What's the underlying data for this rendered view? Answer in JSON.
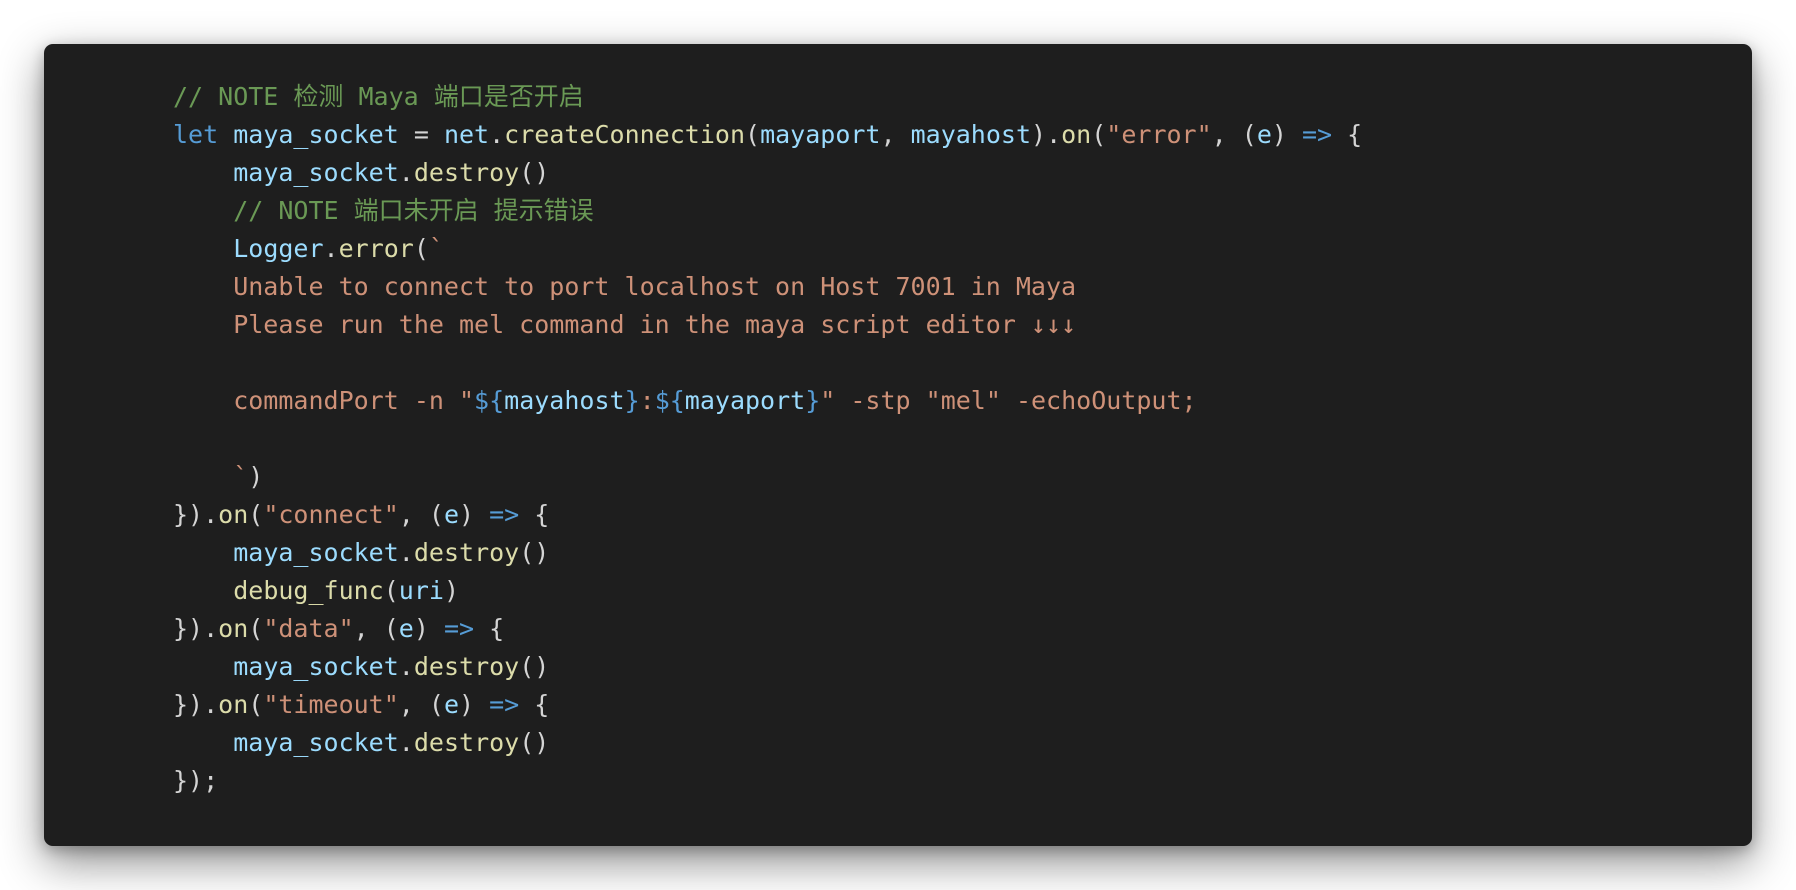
{
  "editor": {
    "background": "#1e1e1e",
    "font_size_hint": "monospace code snippet",
    "colors": {
      "default": "#d4d4d4",
      "comment": "#6a9955",
      "keyword": "#569cd6",
      "variable": "#9cdcfe",
      "function": "#dcdcaa",
      "string": "#ce9178"
    },
    "lines": [
      [
        {
          "t": "// NOTE 检测 Maya 端口是否开启",
          "c": "comment"
        }
      ],
      [
        {
          "t": "let",
          "c": "keyword"
        },
        {
          "t": " ",
          "c": "default"
        },
        {
          "t": "maya_socket",
          "c": "variable"
        },
        {
          "t": " = ",
          "c": "default"
        },
        {
          "t": "net",
          "c": "variable"
        },
        {
          "t": ".",
          "c": "default"
        },
        {
          "t": "createConnection",
          "c": "function"
        },
        {
          "t": "(",
          "c": "default"
        },
        {
          "t": "mayaport",
          "c": "variable"
        },
        {
          "t": ", ",
          "c": "default"
        },
        {
          "t": "mayahost",
          "c": "variable"
        },
        {
          "t": ").",
          "c": "default"
        },
        {
          "t": "on",
          "c": "function"
        },
        {
          "t": "(",
          "c": "default"
        },
        {
          "t": "\"error\"",
          "c": "string"
        },
        {
          "t": ", (",
          "c": "default"
        },
        {
          "t": "e",
          "c": "variable"
        },
        {
          "t": ") ",
          "c": "default"
        },
        {
          "t": "=>",
          "c": "keyword"
        },
        {
          "t": " {",
          "c": "default"
        }
      ],
      [
        {
          "t": "    ",
          "c": "default"
        },
        {
          "t": "maya_socket",
          "c": "variable"
        },
        {
          "t": ".",
          "c": "default"
        },
        {
          "t": "destroy",
          "c": "function"
        },
        {
          "t": "()",
          "c": "default"
        }
      ],
      [
        {
          "t": "    ",
          "c": "default"
        },
        {
          "t": "// NOTE 端口未开启 提示错误",
          "c": "comment"
        }
      ],
      [
        {
          "t": "    ",
          "c": "default"
        },
        {
          "t": "Logger",
          "c": "variable"
        },
        {
          "t": ".",
          "c": "default"
        },
        {
          "t": "error",
          "c": "function"
        },
        {
          "t": "(",
          "c": "default"
        },
        {
          "t": "`",
          "c": "string"
        }
      ],
      [
        {
          "t": "    Unable to connect to port localhost on Host 7001 in Maya",
          "c": "string"
        }
      ],
      [
        {
          "t": "    Please run the mel command in the maya script editor ↓↓↓",
          "c": "string"
        }
      ],
      [
        {
          "t": "",
          "c": "default"
        }
      ],
      [
        {
          "t": "    commandPort -n \"",
          "c": "string"
        },
        {
          "t": "${",
          "c": "keyword"
        },
        {
          "t": "mayahost",
          "c": "variable"
        },
        {
          "t": "}",
          "c": "keyword"
        },
        {
          "t": ":",
          "c": "string"
        },
        {
          "t": "${",
          "c": "keyword"
        },
        {
          "t": "mayaport",
          "c": "variable"
        },
        {
          "t": "}",
          "c": "keyword"
        },
        {
          "t": "\" -stp \"mel\" -echoOutput;",
          "c": "string"
        }
      ],
      [
        {
          "t": "",
          "c": "default"
        }
      ],
      [
        {
          "t": "    `",
          "c": "string"
        },
        {
          "t": ")",
          "c": "default"
        }
      ],
      [
        {
          "t": "}).",
          "c": "default"
        },
        {
          "t": "on",
          "c": "function"
        },
        {
          "t": "(",
          "c": "default"
        },
        {
          "t": "\"connect\"",
          "c": "string"
        },
        {
          "t": ", (",
          "c": "default"
        },
        {
          "t": "e",
          "c": "variable"
        },
        {
          "t": ") ",
          "c": "default"
        },
        {
          "t": "=>",
          "c": "keyword"
        },
        {
          "t": " {",
          "c": "default"
        }
      ],
      [
        {
          "t": "    ",
          "c": "default"
        },
        {
          "t": "maya_socket",
          "c": "variable"
        },
        {
          "t": ".",
          "c": "default"
        },
        {
          "t": "destroy",
          "c": "function"
        },
        {
          "t": "()",
          "c": "default"
        }
      ],
      [
        {
          "t": "    ",
          "c": "default"
        },
        {
          "t": "debug_func",
          "c": "function"
        },
        {
          "t": "(",
          "c": "default"
        },
        {
          "t": "uri",
          "c": "variable"
        },
        {
          "t": ")",
          "c": "default"
        }
      ],
      [
        {
          "t": "}).",
          "c": "default"
        },
        {
          "t": "on",
          "c": "function"
        },
        {
          "t": "(",
          "c": "default"
        },
        {
          "t": "\"data\"",
          "c": "string"
        },
        {
          "t": ", (",
          "c": "default"
        },
        {
          "t": "e",
          "c": "variable"
        },
        {
          "t": ") ",
          "c": "default"
        },
        {
          "t": "=>",
          "c": "keyword"
        },
        {
          "t": " {",
          "c": "default"
        }
      ],
      [
        {
          "t": "    ",
          "c": "default"
        },
        {
          "t": "maya_socket",
          "c": "variable"
        },
        {
          "t": ".",
          "c": "default"
        },
        {
          "t": "destroy",
          "c": "function"
        },
        {
          "t": "()",
          "c": "default"
        }
      ],
      [
        {
          "t": "}).",
          "c": "default"
        },
        {
          "t": "on",
          "c": "function"
        },
        {
          "t": "(",
          "c": "default"
        },
        {
          "t": "\"timeout\"",
          "c": "string"
        },
        {
          "t": ", (",
          "c": "default"
        },
        {
          "t": "e",
          "c": "variable"
        },
        {
          "t": ") ",
          "c": "default"
        },
        {
          "t": "=>",
          "c": "keyword"
        },
        {
          "t": " {",
          "c": "default"
        }
      ],
      [
        {
          "t": "    ",
          "c": "default"
        },
        {
          "t": "maya_socket",
          "c": "variable"
        },
        {
          "t": ".",
          "c": "default"
        },
        {
          "t": "destroy",
          "c": "function"
        },
        {
          "t": "()",
          "c": "default"
        }
      ],
      [
        {
          "t": "});",
          "c": "default"
        }
      ]
    ]
  }
}
